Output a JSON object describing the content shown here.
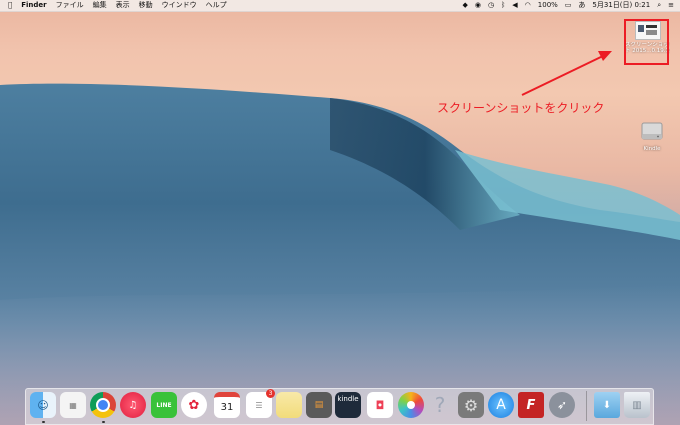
{
  "menubar": {
    "apple_icon": "apple-icon",
    "app_name": "Finder",
    "menus": [
      "ファイル",
      "編集",
      "表示",
      "移動",
      "ウインドウ",
      "ヘルプ"
    ],
    "status_icons": [
      "dropbox-icon",
      "eye-icon",
      "clock-icon",
      "bluetooth-icon",
      "volume-icon",
      "wifi-icon"
    ],
    "battery": "100%",
    "ime_indicator": "あ",
    "datetime": "5月31日(日)  0:21",
    "search_icon": "spotlight-icon",
    "list_icon": "notification-center-icon"
  },
  "desktop": {
    "screenshot_file": {
      "label_line1": "スクリーンショット",
      "label_line2": "ト 2015...0.19.11"
    },
    "annotation": "スクリーンショットをクリック",
    "kindle_disk": {
      "label": "Kindle"
    },
    "colors": {
      "annotation": "#ec1c24"
    }
  },
  "dock": {
    "items": [
      {
        "name": "Finder",
        "icon": "finder-icon"
      },
      {
        "name": "Launchpad",
        "icon": "launchpad-icon"
      },
      {
        "name": "Google Chrome",
        "icon": "chrome-icon"
      },
      {
        "name": "iTunes",
        "icon": "itunes-icon"
      },
      {
        "name": "LINE",
        "icon": "line-icon",
        "text": "LINE"
      },
      {
        "name": "Flower",
        "icon": "flower-app-icon"
      },
      {
        "name": "Calendar",
        "icon": "calendar-icon",
        "text": "31"
      },
      {
        "name": "Reminders",
        "icon": "reminders-icon",
        "badge": "3"
      },
      {
        "name": "Notes",
        "icon": "notes-icon"
      },
      {
        "name": "Calculator",
        "icon": "calculator-icon"
      },
      {
        "name": "Kindle",
        "icon": "kindle-icon",
        "text": "kindle"
      },
      {
        "name": "Pocket",
        "icon": "pocket-icon"
      },
      {
        "name": "Photos",
        "icon": "photos-icon"
      },
      {
        "name": "Help",
        "icon": "help-icon",
        "text": "?"
      },
      {
        "name": "System Preferences",
        "icon": "system-preferences-icon"
      },
      {
        "name": "App Store",
        "icon": "app-store-icon"
      },
      {
        "name": "FileZilla",
        "icon": "filezilla-icon"
      },
      {
        "name": "Rocket",
        "icon": "rocket-icon"
      },
      {
        "name": "Downloads",
        "icon": "downloads-folder-icon"
      },
      {
        "name": "Trash",
        "icon": "trash-icon"
      }
    ]
  }
}
